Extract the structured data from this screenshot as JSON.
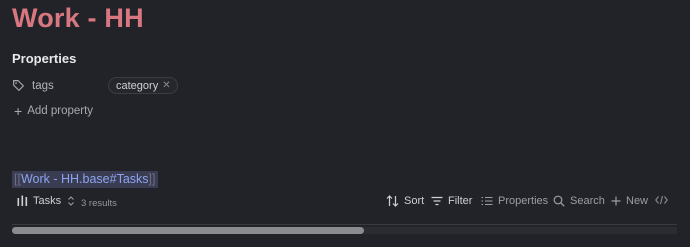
{
  "page": {
    "title": "Work - HH"
  },
  "properties": {
    "heading": "Properties",
    "rows": [
      {
        "key": "tags",
        "icon": "tag-icon",
        "values": [
          "category"
        ]
      }
    ],
    "add_label": "Add property"
  },
  "embed": {
    "open_brackets": "[[",
    "link_text": "Work - HH.base#Tasks",
    "close_brackets": "]]"
  },
  "base_toolbar": {
    "view_name": "Tasks",
    "results_count": "3 results",
    "sort_label": "Sort",
    "filter_label": "Filter",
    "properties_label": "Properties",
    "search_label": "Search",
    "new_label": "New",
    "code_icon": "code-icon"
  },
  "scrollbar": {
    "thumb_fraction": 0.53
  },
  "colors": {
    "background": "#222329",
    "title": "#d97780",
    "link": "#8ea3f0",
    "link_highlight": "#3a3d52"
  }
}
